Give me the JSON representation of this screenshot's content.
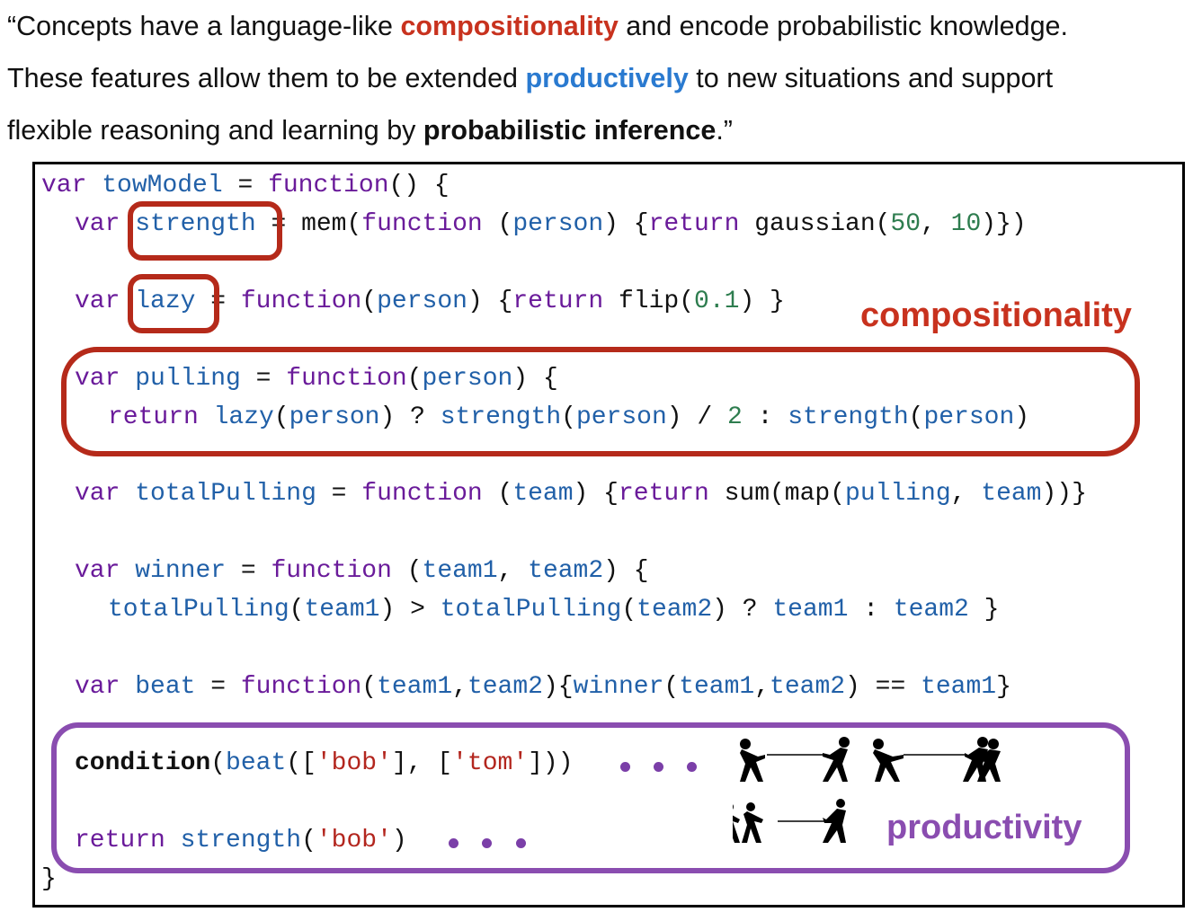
{
  "quote": {
    "line1_pre": "“Concepts have a language-like ",
    "line1_hl": "compositionality",
    "line1_post": " and encode probabilistic knowledge.",
    "line2_pre": "These features allow them to be extended ",
    "line2_hl": "productively",
    "line2_post": " to new situations and support",
    "line3_pre": "flexible reasoning and learning by ",
    "line3_hl": "probabilistic inference",
    "line3_post": ".”"
  },
  "labels": {
    "compositionality": "compositionality",
    "productivity": "productivity"
  },
  "code": {
    "l1": {
      "kw": "var",
      "id": "towModel",
      "eq": " = ",
      "fn": "function",
      "rest": "() {"
    },
    "l2": {
      "kw": "var",
      "id": "strength",
      "eq": " = mem(",
      "fn": "function",
      "p1": " (",
      "arg": "person",
      "p2": ") {",
      "ret": "return",
      "g": " gaussian(",
      "n1": "50",
      "c": ", ",
      "n2": "10",
      "end": ")})"
    },
    "l3": {
      "kw": "var",
      "id": "lazy",
      "eq": " = ",
      "fn": "function",
      "p1": "(",
      "arg": "person",
      "p2": ") {",
      "ret": "return",
      "f": " flip(",
      "n": "0.1",
      "end": ") }"
    },
    "l4": {
      "kw": "var",
      "id": "pulling",
      "eq": " = ",
      "fn": "function",
      "p1": "(",
      "arg": "person",
      "p2": ") {"
    },
    "l5": {
      "ret": "return",
      "lz": " lazy",
      "p1": "(",
      "a1": "person",
      "p2": ") ? ",
      "s1": "strength",
      "p3": "(",
      "a2": "person",
      "p4": ") / ",
      "n": "2",
      "p5": " : ",
      "s2": "strength",
      "p6": "(",
      "a3": "person",
      "p7": ")"
    },
    "l6": {
      "kw": "var",
      "id": "totalPulling",
      "eq": " = ",
      "fn": "function",
      "p1": " (",
      "arg": "team",
      "p2": ") {",
      "ret": "return",
      "sum": " sum(map(",
      "pl": "pulling",
      "c": ", ",
      "tm": "team",
      "end": "))}"
    },
    "l7": {
      "kw": "var",
      "id": "winner",
      "eq": " = ",
      "fn": "function",
      "p1": " (",
      "a1": "team1",
      "c": ", ",
      "a2": "team2",
      "p2": ") {"
    },
    "l8": {
      "t1": "totalPulling",
      "p1": "(",
      "a1": "team1",
      "p2": ") > ",
      "t2": "totalPulling",
      "p3": "(",
      "a2": "team2",
      "p4": ") ? ",
      "a3": "team1",
      "p5": " : ",
      "a4": "team2",
      "p6": " }"
    },
    "l9": {
      "kw": "var",
      "id": "beat",
      "eq": " = ",
      "fn": "function",
      "p1": "(",
      "a1": "team1",
      "c1": ",",
      "a2": "team2",
      "p2": "){",
      "w": "winner",
      "p3": "(",
      "a3": "team1",
      "c2": ",",
      "a4": "team2",
      "p4": ") == ",
      "a5": "team1",
      "p5": "}"
    },
    "l10": {
      "cond": "condition",
      "p1": "(",
      "bt": "beat",
      "p2": "([",
      "s1": "'bob'",
      "p3": "], [",
      "s2": "'tom'",
      "p4": "]))"
    },
    "l11": {
      "ret": "return",
      "st": " strength",
      "p1": "(",
      "s1": "'bob'",
      "p2": ")"
    },
    "close": "}"
  },
  "colors": {
    "keyword": "#6a1b9a",
    "identifier": "#2160a8",
    "number": "#2e7d4f",
    "string": "#b3261e",
    "compositionality": "#c8321e",
    "productivity": "#8a4db0"
  },
  "icons": [
    "tug-of-war-silhouette-icon"
  ]
}
